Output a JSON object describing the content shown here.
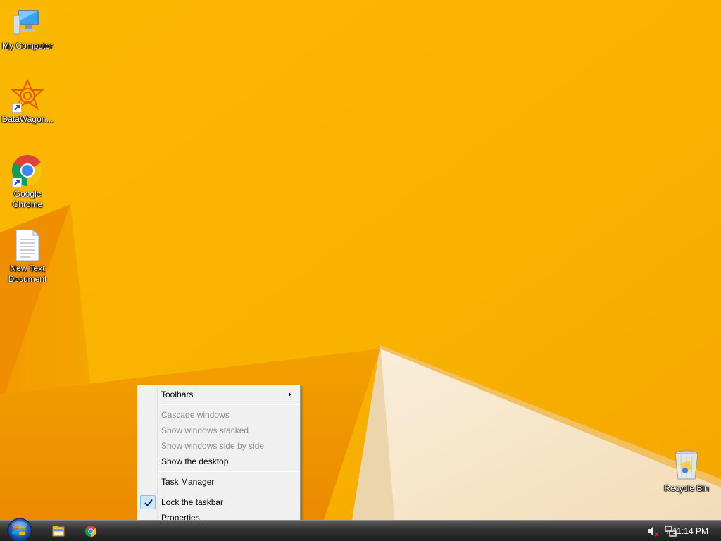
{
  "desktop": {
    "icons": [
      {
        "label": "My Computer",
        "icon": "computer-icon"
      },
      {
        "label": "DataWagon...",
        "icon": "datawagon-icon"
      },
      {
        "label_line1": "Google",
        "label_line2": "Chrome",
        "icon": "chrome-icon"
      },
      {
        "label_line1": "New Text",
        "label_line2": "Document",
        "icon": "text-document-icon"
      },
      {
        "label": "Recycle Bin",
        "icon": "recycle-bin-icon"
      }
    ]
  },
  "context_menu": {
    "items": [
      {
        "label": "Toolbars",
        "enabled": true,
        "submenu": true
      },
      {
        "label": "Cascade windows",
        "enabled": false
      },
      {
        "label": "Show windows stacked",
        "enabled": false
      },
      {
        "label": "Show windows side by side",
        "enabled": false
      },
      {
        "label": "Show the desktop",
        "enabled": true
      },
      {
        "label": "Task Manager",
        "enabled": true
      },
      {
        "label": "Lock the taskbar",
        "enabled": true,
        "checked": true
      },
      {
        "label": "Properties",
        "enabled": true
      }
    ]
  },
  "taskbar": {
    "pinned": [
      {
        "icon": "file-explorer-icon"
      },
      {
        "icon": "chrome-icon"
      }
    ],
    "tray": {
      "volume_icon": "volume-muted-icon",
      "network_icon": "network-icon",
      "clock": "11:14 PM"
    }
  },
  "colors": {
    "wallpaper_primary": "#f7b500",
    "wallpaper_shadow": "#ee8e00",
    "wallpaper_light": "#f6e6cc",
    "menu_background": "#f0f0f0",
    "check_highlight": "#cde8f6"
  }
}
